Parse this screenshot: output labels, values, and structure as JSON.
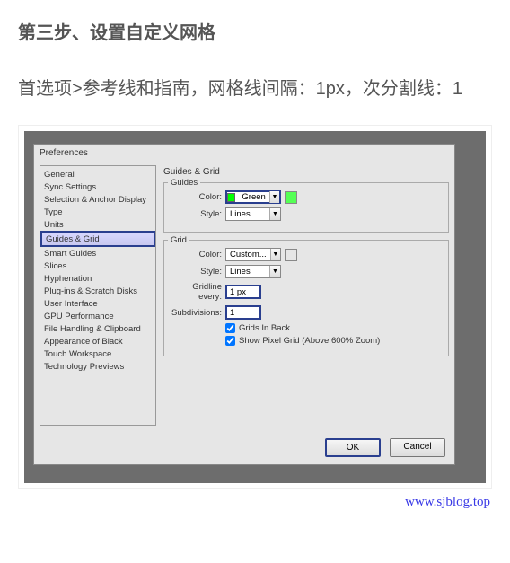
{
  "article": {
    "step_title": "第三步、设置自定义网格",
    "step_desc": "首选项>参考线和指南，网格线间隔：1px，次分割线：1"
  },
  "dialog": {
    "title": "Preferences",
    "sidebar_items": [
      "General",
      "Sync Settings",
      "Selection & Anchor Display",
      "Type",
      "Units",
      "Guides & Grid",
      "Smart Guides",
      "Slices",
      "Hyphenation",
      "Plug-ins & Scratch Disks",
      "User Interface",
      "GPU Performance",
      "File Handling & Clipboard",
      "Appearance of Black",
      "Touch Workspace",
      "Technology Previews"
    ],
    "selected_sidebar_index": 5,
    "panel_heading": "Guides & Grid",
    "guides_section": {
      "legend": "Guides",
      "color_label": "Color:",
      "color_value": "Green",
      "color_swatch": "#00ff00",
      "style_label": "Style:",
      "style_value": "Lines"
    },
    "grid_section": {
      "legend": "Grid",
      "color_label": "Color:",
      "color_value": "Custom...",
      "style_label": "Style:",
      "style_value": "Lines",
      "gridline_every_label": "Gridline every:",
      "gridline_every_value": "1 px",
      "subdivisions_label": "Subdivisions:",
      "subdivisions_value": "1",
      "grids_in_back_label": "Grids In Back",
      "grids_in_back_checked": true,
      "show_pixel_grid_label": "Show Pixel Grid (Above 600% Zoom)",
      "show_pixel_grid_checked": true
    },
    "buttons": {
      "ok": "OK",
      "cancel": "Cancel"
    }
  },
  "watermark": "www.sjblog.top"
}
